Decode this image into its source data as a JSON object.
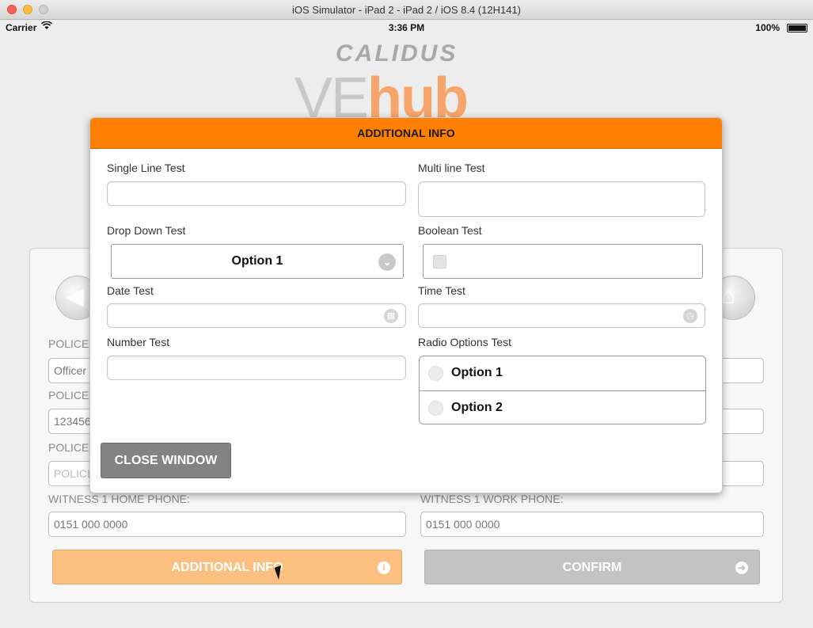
{
  "window": {
    "title": "iOS Simulator - iPad 2 - iPad 2 / iOS 8.4 (12H141)"
  },
  "status_bar": {
    "carrier": "Carrier",
    "time": "3:36 PM",
    "battery": "100%"
  },
  "logo": {
    "top": "CALIDUS",
    "bottom_prefix": "VE",
    "bottom_suffix": "hub"
  },
  "background": {
    "fields": [
      {
        "label": "POLICE",
        "value": "Officer"
      },
      {
        "label": "POLICE",
        "value": "123456"
      },
      {
        "label": "POLICE",
        "placeholder": "POLICE"
      }
    ],
    "home_phone": {
      "label": "WITNESS 1 HOME PHONE:",
      "value": "0151 000 0000"
    },
    "work_phone": {
      "label": "WITNESS 1 WORK PHONE:",
      "value": "0151 000 0000"
    },
    "additional_info_button": "ADDITIONAL INFO",
    "confirm_button": "CONFIRM"
  },
  "modal": {
    "title": "ADDITIONAL INFO",
    "single_line": {
      "label": "Single Line Test",
      "value": ""
    },
    "multi_line": {
      "label": "Multi line Test",
      "value": ""
    },
    "drop_down": {
      "label": "Drop Down Test",
      "selected": "Option 1"
    },
    "boolean": {
      "label": "Boolean Test",
      "checked": false
    },
    "date": {
      "label": "Date Test",
      "value": ""
    },
    "time": {
      "label": "Time Test",
      "value": ""
    },
    "number": {
      "label": "Number Test",
      "value": ""
    },
    "radio": {
      "label": "Radio Options Test",
      "options": [
        "Option 1",
        "Option 2"
      ]
    },
    "close_button": "CLOSE WINDOW"
  },
  "colors": {
    "accent": "#ff8000",
    "button_faded": "#fbbf80",
    "close_button": "#838383"
  }
}
